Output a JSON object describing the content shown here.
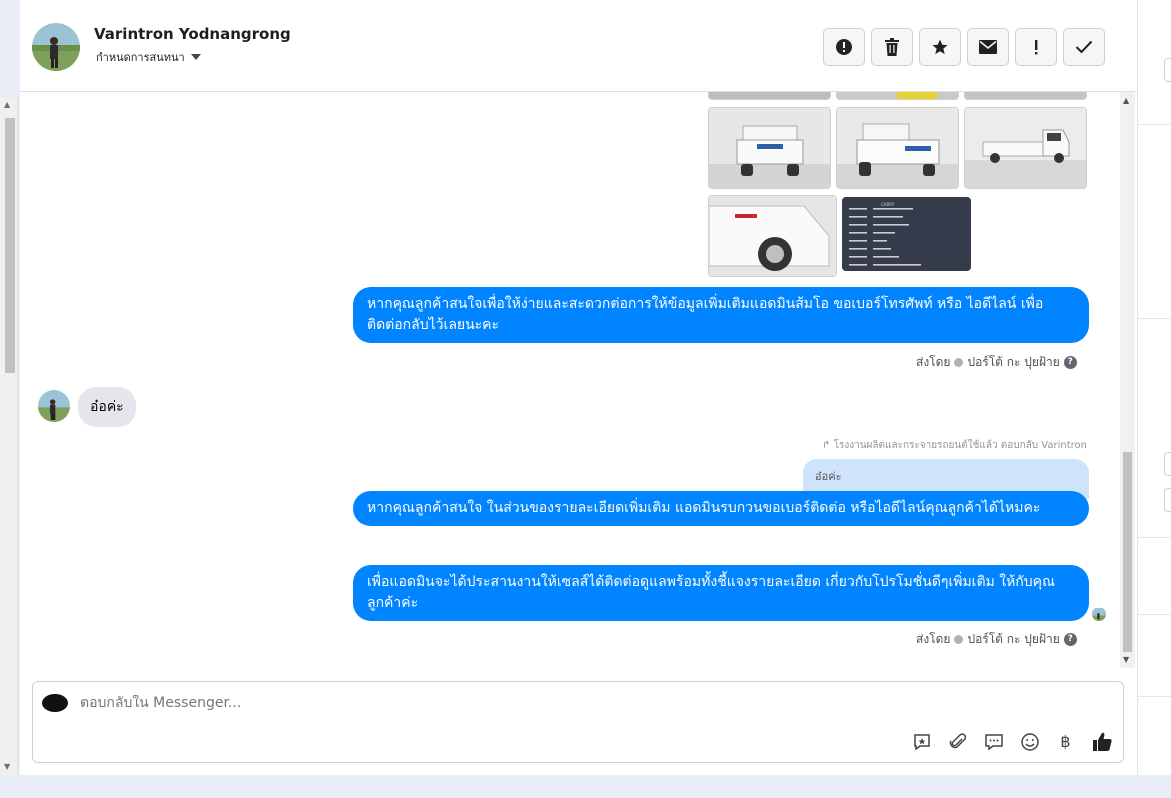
{
  "header": {
    "name": "Varintron Yodnangrong",
    "subtitle": "กำหนดการสนทนา",
    "toolbar": [
      {
        "icon": "alert-circle-icon"
      },
      {
        "icon": "trash-icon"
      },
      {
        "icon": "star-icon"
      },
      {
        "icon": "mail-icon"
      },
      {
        "icon": "exclamation-icon"
      },
      {
        "icon": "check-icon"
      }
    ]
  },
  "thread": {
    "msg1": "หากคุณลูกค้าสนใจเพื่อให้ง่ายและสะดวกต่อการให้ข้อมูลเพิ่มเติมแอดมินส้มโอ ขอเบอร์โทรศัพท์ หรือ ไอดีไลน์ เพื่อติดต่อกลับไว้เลยนะคะ",
    "meta_sent_by": "ส่งโดย",
    "meta_agent": "ปอร์โต้ กะ ปุยฝ้าย",
    "incoming": "อ๋อค่ะ",
    "reply_note": "โรงงานผลิตและกระจายรถยนต์ใช้แล้ว ตอบกลับ Varintron",
    "quoted": "อ๋อค่ะ",
    "msg2": "หากคุณลูกค้าสนใจ ในส่วนของรายละเอียดเพิ่มเติม แอดมินรบกวนขอเบอร์ติดต่อ หรือไอดีไลน์คุณลูกค้าได้ไหมคะ",
    "msg3": "เพื่อแอดมินจะได้ประสานงานให้เซลส์ได้ติดต่อดูแลพร้อมทั้งชี้แจงรายละเอียด เกี่ยวกับโปรโมชั่นดีๆเพิ่มเติม ให้กับคุณลูกค้าค่ะ",
    "spec_sheet_label": "CARRY"
  },
  "composer": {
    "placeholder": "ตอบกลับใน Messenger..."
  },
  "colors": {
    "accent": "#0084ff",
    "incoming_bubble": "#e4e6eb",
    "quote_bubble": "#cfe3fb"
  }
}
